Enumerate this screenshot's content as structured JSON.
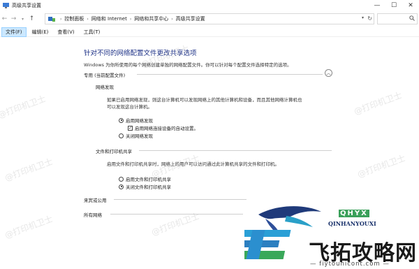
{
  "window": {
    "title": "高级共享设置"
  },
  "addressbar": {
    "crumbs": [
      "控制面板",
      "网络和 Internet",
      "网络和共享中心",
      "高级共享设置"
    ]
  },
  "menubar": {
    "items": [
      "文件(F)",
      "编辑(E)",
      "查看(V)",
      "工具(T)"
    ]
  },
  "content": {
    "title": "针对不同的网络配置文件更改共享选项",
    "subtitle": "Windows 为你所使用的每个网络创建单独的网络配置文件。你可以针对每个配置文件选择特定的选项。",
    "private_profile": {
      "label": "专用 (当前配置文件)",
      "network_discovery": {
        "label": "网络发现",
        "desc_line1": "如果已启用网络发现，则这台计算机可以发现网络上的其他计算机和设备，而且其他网络计算机也",
        "desc_line2": "可以发现这台计算机。",
        "opt_on": "启用网络发现",
        "opt_auto": "启用网络连接设备的自动设置。",
        "opt_off": "关闭网络发现"
      },
      "file_printer_sharing": {
        "label": "文件和打印机共享",
        "desc": "启用文件和打印机共享时，网络上的用户可以访问通过此计算机共享的文件和打印机。",
        "opt_on": "启用文件和打印机共享",
        "opt_off": "关闭文件和打印机共享"
      }
    },
    "guest_profile": {
      "label": "来宾或公用"
    },
    "all_networks": {
      "label": "所有网络"
    }
  },
  "watermarks": [
    "@打印机卫士"
  ],
  "logo": {
    "abbr": "QHYX",
    "english": "QINHANYOUXI",
    "chinese": "飞拓攻略网",
    "url": "— fiytounicont.com —"
  },
  "colors": {
    "title_blue": "#1e3287",
    "menu_active": "#cce8ff"
  }
}
